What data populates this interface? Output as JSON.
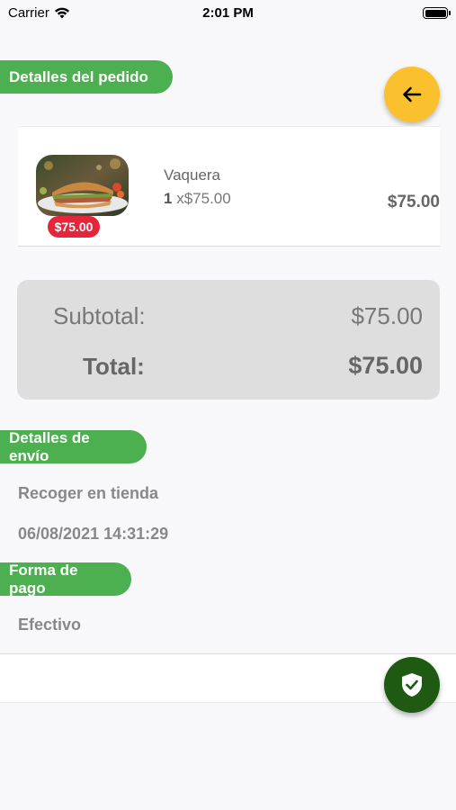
{
  "status_bar": {
    "carrier": "Carrier",
    "time": "2:01 PM",
    "icons": [
      "wifi-icon",
      "battery-icon"
    ]
  },
  "order_details": {
    "header": "Detalles del pedido",
    "items": [
      {
        "name": "Vaquera",
        "quantity": "1",
        "unit_price": "x$75.00",
        "price_badge": "$75.00",
        "total": "$75.00",
        "image": "sandwich-photo"
      }
    ]
  },
  "back_button": {
    "icon": "arrow-left-icon",
    "color": "#fbc02d"
  },
  "totals": {
    "subtotal_label": "Subtotal:",
    "subtotal_value": "$75.00",
    "total_label": "Total:",
    "total_value": "$75.00"
  },
  "shipping": {
    "header": "Detalles de envío",
    "method": "Recoger en tienda",
    "datetime": "06/08/2021 14:31:29"
  },
  "payment": {
    "header": "Forma de pago",
    "method": "Efectivo"
  },
  "confirm_button": {
    "icon": "shield-check-icon",
    "color": "#1f5a12"
  },
  "colors": {
    "section_pill": "#4caf50",
    "price_badge": "#e5263a",
    "back_button": "#fbc02d",
    "confirm_button": "#1f5a12"
  }
}
